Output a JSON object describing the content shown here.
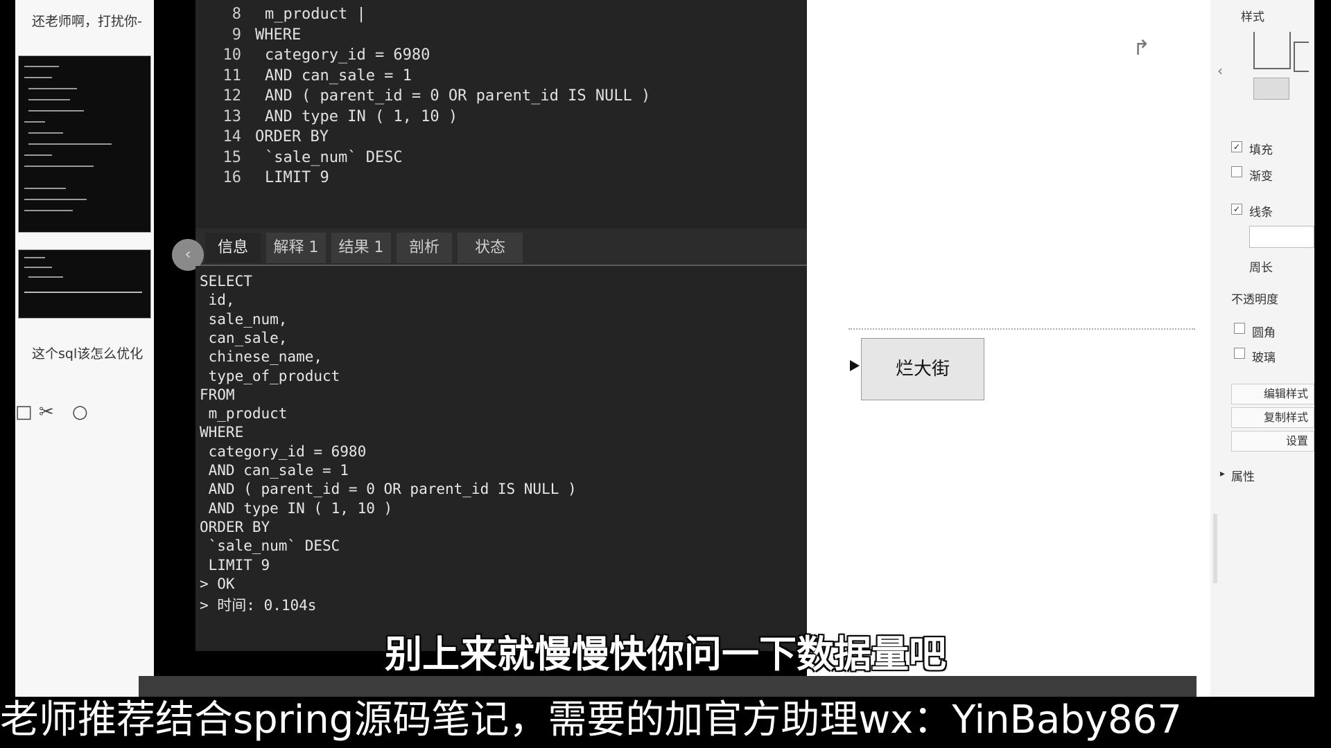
{
  "chat": {
    "message_top": "还老师啊，打扰你-",
    "message_question": "这个sql该怎么优化",
    "icons": [
      "copy-icon",
      "scissors-icon",
      "comment-icon"
    ]
  },
  "editor": {
    "lines": [
      {
        "num": "8",
        "code": "m_product |",
        "indent": 1
      },
      {
        "num": "9",
        "code": "WHERE",
        "indent": 0
      },
      {
        "num": "10",
        "code": "category_id = 6980",
        "indent": 1
      },
      {
        "num": "11",
        "code": "AND can_sale = 1",
        "indent": 1
      },
      {
        "num": "12",
        "code": "AND ( parent_id = 0 OR parent_id IS NULL )",
        "indent": 1
      },
      {
        "num": "13",
        "code": "AND type IN ( 1, 10 )",
        "indent": 1
      },
      {
        "num": "14",
        "code": "ORDER BY",
        "indent": 0
      },
      {
        "num": "15",
        "code": "`sale_num` DESC",
        "indent": 1
      },
      {
        "num": "16",
        "code": "LIMIT 9",
        "indent": 1
      }
    ]
  },
  "result_tabs": [
    "信息",
    "解释 1",
    "结果 1",
    "剖析",
    "状态"
  ],
  "result": {
    "lines": [
      "SELECT",
      " id,",
      " sale_num,",
      " can_sale,",
      " chinese_name,",
      " type_of_product",
      "FROM",
      " m_product",
      "WHERE",
      " category_id = 6980",
      " AND can_sale = 1",
      " AND ( parent_id = 0 OR parent_id IS NULL )",
      " AND type IN ( 1, 10 )",
      "ORDER BY",
      " `sale_num` DESC",
      " LIMIT 9",
      "> OK",
      "> 时间: 0.104s"
    ]
  },
  "canvas": {
    "node_label": "烂大街"
  },
  "props": {
    "style_title": "样式",
    "fill": "填充",
    "gradient": "渐变",
    "line": "线条",
    "perimeter": "周长",
    "opacity": "不透明度",
    "rounded": "圆角",
    "glass": "玻璃",
    "edit_style": "编辑样式",
    "copy_style": "复制样式",
    "settings": "设置",
    "properties": "属性"
  },
  "subtitle": "别上来就慢慢快你问一下数据量吧",
  "banner": "老师推荐结合spring源码笔记，需要的加官方助理wx：YinBaby867"
}
